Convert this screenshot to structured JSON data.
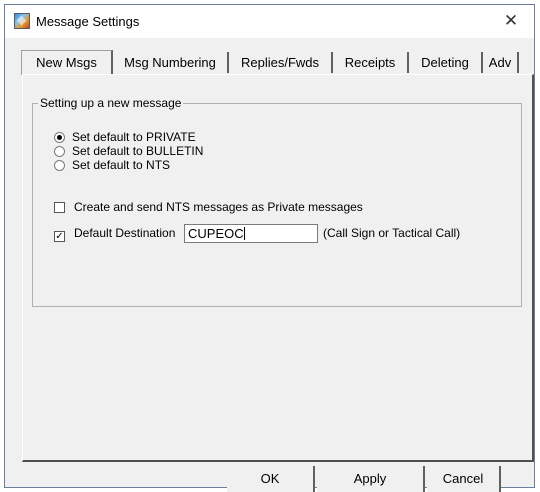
{
  "window": {
    "title": "Message Settings",
    "close_glyph": "✕",
    "icon": "app-icon"
  },
  "tabs": [
    {
      "label": "New Msgs",
      "active": true
    },
    {
      "label": "Msg Numbering",
      "active": false
    },
    {
      "label": "Replies/Fwds",
      "active": false
    },
    {
      "label": "Receipts",
      "active": false
    },
    {
      "label": "Deleting",
      "active": false
    },
    {
      "label": "Adv",
      "active": false
    }
  ],
  "group": {
    "label": "Setting up a new message",
    "radios": [
      {
        "label": "Set default to PRIVATE",
        "checked": true
      },
      {
        "label": "Set default to BULLETIN",
        "checked": false
      },
      {
        "label": "Set default to NTS",
        "checked": false
      }
    ],
    "nts_private": {
      "label": "Create and send NTS messages as Private messages",
      "checked": false
    },
    "default_destination": {
      "label": "Default Destination",
      "checked": true,
      "value": "CUPEOC",
      "hint": "(Call Sign or Tactical Call)"
    }
  },
  "buttons": {
    "ok": "OK",
    "apply": "Apply",
    "cancel": "Cancel"
  }
}
